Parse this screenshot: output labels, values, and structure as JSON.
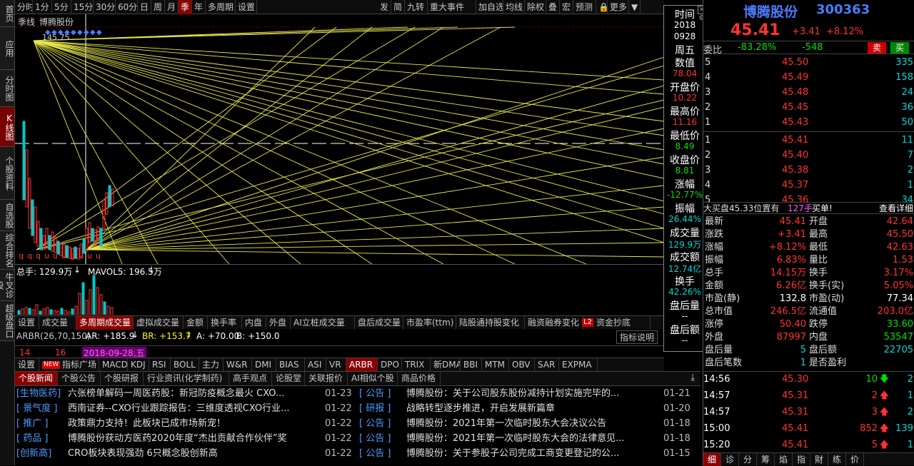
{
  "left_tabs": [
    "首页",
    "应用",
    "分时图",
    "K线图",
    "个股资料",
    "自选股",
    "综合排名",
    "牛叉诊股",
    "超级盘口"
  ],
  "toolbar": {
    "periods": [
      "分时",
      "1分",
      "5分",
      "15分",
      "30分",
      "60分",
      "日",
      "周",
      "月",
      "季",
      "年",
      "多周期",
      "设置"
    ],
    "right": [
      "发",
      "简",
      "九转",
      "重大事件",
      "加自选",
      "均线",
      "除权",
      "叠",
      "宏",
      "预测",
      "更多"
    ]
  },
  "chart": {
    "period_label": "季线",
    "stock_name": "博腾股份",
    "high_label": "145.75",
    "k_markers": "q q q u u u q u u u",
    "mavol": {
      "total_label": "总手: 129.9万",
      "mavol5": "MAVOL5: 196.5万"
    }
  },
  "indicator": {
    "arbr_title": "ARBR(26,70,150)",
    "ar": "AR: +185.9",
    "br": "BR: +153.7",
    "a": "A: +70.00",
    "b": "B: +150.0",
    "explain": "指标说明",
    "settings": "设置",
    "new_badge": "NEW"
  },
  "time_axis": {
    "t1": "14",
    "t2": "16",
    "t3": "2018-09-28,五"
  },
  "vol_tabs": [
    "设置",
    "成交量",
    "多周期成交量",
    "虚拟成交量",
    "金额",
    "换手率",
    "内盘",
    "外盘",
    "AI立桩成交量",
    "盘后成交量",
    "市盈率(ttm)",
    "陆股通持股变化",
    "融资融券变化",
    "资金抄底"
  ],
  "vol_badge": "L2",
  "ind_tabs": [
    "指标广场",
    "MACD",
    "KDJ",
    "RSI",
    "BOLL",
    "主力",
    "W&R",
    "DMI",
    "BIAS",
    "ASI",
    "VR",
    "ARBR",
    "DPO",
    "TRIX",
    "新DMA",
    "BBI",
    "MTM",
    "OBV",
    "SAR",
    "EXPMA"
  ],
  "news_tabs": [
    "个股新闻",
    "个股公告",
    "个股研报",
    "行业资讯(化学制药)",
    "高手观点",
    "论股堂",
    "关联报价",
    "AI相似个股",
    "商品价格"
  ],
  "news_left": [
    {
      "tag": "[生物医药]",
      "title": "六张榜单解码一周医药股：新冠防疫概念最火 CXO...",
      "date": "01-23"
    },
    {
      "tag": "[ 景气度 ]",
      "title": "西南证券--CXO行业跟踪报告：三维度透视CXO行业...",
      "date": "01-22"
    },
    {
      "tag": "[ 推广 ]",
      "title": "政策鼎力支持！此板块已成市场新宠！",
      "date": "01-22"
    },
    {
      "tag": "[ 药品 ]",
      "title": "博腾股份获动方医药2020年度“杰出贡献合作伙伴”奖",
      "date": "01-22"
    },
    {
      "tag": "[创新高]",
      "title": "CRO板块表现强劲 6只概念股创新高",
      "date": "01-22"
    }
  ],
  "news_right": [
    {
      "tag": "[ 公告 ]",
      "title": "博腾股份：关于公司股东股份减持计划实施完毕的...",
      "date": "01-21"
    },
    {
      "tag": "[ 研报 ]",
      "title": "战略转型逐步推进，开启发展新篇章",
      "date": "01-20"
    },
    {
      "tag": "[ 公告 ]",
      "title": "博腾股份：2021年第一次临时股东大会决议公告",
      "date": "01-18"
    },
    {
      "tag": "[ 公告 ]",
      "title": "博腾股份：2021年第一次临时股东大会的法律意见...",
      "date": "01-18"
    },
    {
      "tag": "[ 公告 ]",
      "title": "博腾股份：关于参股子公司完成工商变更登记的公...",
      "date": "01-15"
    }
  ],
  "info_box": {
    "items": [
      {
        "label": "时间",
        "value": "2018"
      },
      {
        "label": "",
        "value": "0928"
      },
      {
        "label": "周五",
        "value": ""
      },
      {
        "label": "数值",
        "value": "78.04"
      },
      {
        "label": "开盘价",
        "value": "10.22"
      },
      {
        "label": "最高价",
        "value": "11.16"
      },
      {
        "label": "最低价",
        "value": "8.49"
      },
      {
        "label": "收盘价",
        "value": "8.81"
      },
      {
        "label": "涨幅",
        "value": "-12.77%"
      },
      {
        "label": "振幅",
        "value": "26.44%"
      },
      {
        "label": "成交量",
        "value": "129.9万"
      },
      {
        "label": "成交额",
        "value": "12.74亿"
      },
      {
        "label": "换手",
        "value": "42.26%"
      },
      {
        "label": "盘后量",
        "value": "--"
      },
      {
        "label": "盘后额",
        "value": "--"
      }
    ]
  },
  "quote": {
    "name": "博腾股份",
    "code": "300363",
    "price": "45.41",
    "change": "+3.41",
    "pct": "+8.12%",
    "weibi_label": "委比",
    "weibi": "-83.28%",
    "weicha": "-548",
    "sell_btn": "卖",
    "buy_btn": "买",
    "sell": [
      {
        "lv": "5",
        "p": "45.50",
        "v": "335"
      },
      {
        "lv": "4",
        "p": "45.49",
        "v": "158"
      },
      {
        "lv": "3",
        "p": "45.48",
        "v": "24"
      },
      {
        "lv": "2",
        "p": "45.45",
        "v": "36"
      },
      {
        "lv": "1",
        "p": "45.43",
        "v": "50"
      }
    ],
    "buy": [
      {
        "lv": "1",
        "p": "45.41",
        "v": "11"
      },
      {
        "lv": "2",
        "p": "45.40",
        "v": "7"
      },
      {
        "lv": "3",
        "p": "45.38",
        "v": "2"
      },
      {
        "lv": "4",
        "p": "45.37",
        "v": "1"
      },
      {
        "lv": "5",
        "p": "45.36",
        "v": "34"
      }
    ],
    "notice": "大买盘45.33位置有",
    "notice_vol": "127手",
    "notice_end": "买单!",
    "detail": "查看详细",
    "stats": [
      [
        "最新",
        "45.41",
        "开盘",
        "42.64"
      ],
      [
        "涨跌",
        "+3.41",
        "最高",
        "45.50"
      ],
      [
        "涨幅",
        "+8.12%",
        "最低",
        "42.63"
      ],
      [
        "振幅",
        "6.83%",
        "量比",
        "1.53"
      ],
      [
        "总手",
        "14.15万",
        "换手",
        "3.17%"
      ],
      [
        "金额",
        "6.26亿",
        "换手(实)",
        "5.05%"
      ],
      [
        "市盈(静)",
        "132.8",
        "市盈(动)",
        "77.34"
      ],
      [
        "总市值",
        "246.5亿",
        "流通值",
        "203.0亿"
      ],
      [
        "涨停",
        "50.40",
        "跌停",
        "33.60"
      ],
      [
        "外盘",
        "87997",
        "内盘",
        "53547"
      ],
      [
        "盘后量",
        "5",
        "盘后额",
        "22705"
      ],
      [
        "盘后笔数",
        "1",
        "是否盈利",
        ""
      ]
    ],
    "ticks": [
      {
        "t": "14:56",
        "p": "45.30",
        "v": "10",
        "d": "down",
        "n": "2"
      },
      {
        "t": "14:57",
        "p": "45.31",
        "v": "2",
        "d": "up",
        "n": "1"
      },
      {
        "t": "14:57",
        "p": "45.31",
        "v": "3",
        "d": "up",
        "n": "2"
      },
      {
        "t": "15:00",
        "p": "45.41",
        "v": "852",
        "d": "up",
        "n": "139"
      },
      {
        "t": "15:20",
        "p": "45.41",
        "v": "5",
        "d": "up",
        "n": "1"
      }
    ],
    "bottom_tabs": [
      "细",
      "诊",
      "分",
      "筹",
      "焰",
      "指",
      "財",
      "练",
      "价"
    ]
  }
}
